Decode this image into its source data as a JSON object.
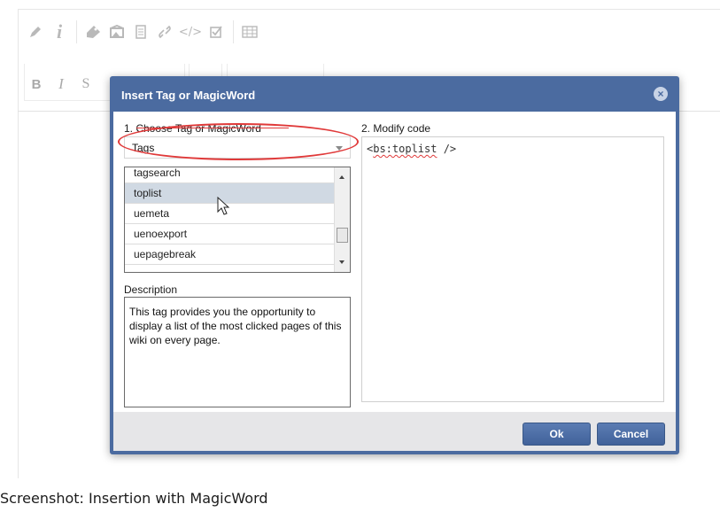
{
  "editor": {
    "toolbar1_icons": [
      "pencil-icon",
      "info-icon",
      "tag-icon",
      "image-icon",
      "template-icon",
      "link-icon",
      "code-icon",
      "checkbox-icon",
      "table-icon"
    ],
    "code_glyph": "</>",
    "toolbar2": {
      "bold": "B",
      "italic": "I",
      "strike": "S"
    }
  },
  "dialog": {
    "title": "Insert Tag or MagicWord",
    "section1_label": "1. Choose Tag or MagicWord",
    "select_value": "Tags",
    "list_items": [
      "tagsearch",
      "toplist",
      "uemeta",
      "uenoexport",
      "uepagebreak"
    ],
    "selected_item": "toplist",
    "description_label": "Description",
    "description_text": "This tag provides you the opportunity to display a list of the most clicked pages of this wiki on every page.",
    "section2_label": "2. Modify code",
    "code": {
      "open": "<",
      "tag": "bs:toplist",
      "close": " />"
    },
    "ok_label": "Ok",
    "cancel_label": "Cancel",
    "close_glyph": "×"
  },
  "caption": "Screenshot: Insertion with MagicWord",
  "colors": {
    "header": "#4b6ba0",
    "highlight": "#e03a3a",
    "selected": "#d0d9e3"
  }
}
